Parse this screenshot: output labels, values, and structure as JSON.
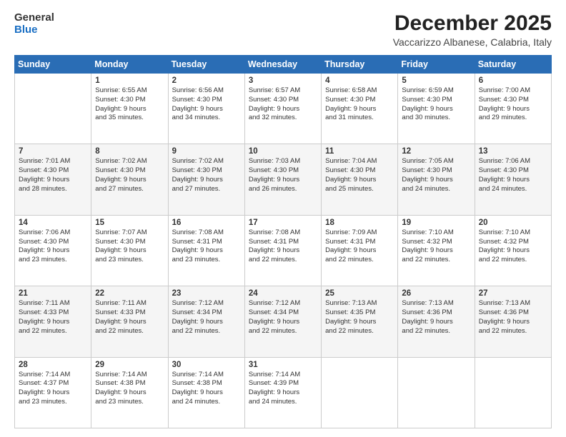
{
  "header": {
    "logo_line1": "General",
    "logo_line2": "Blue",
    "title": "December 2025",
    "subtitle": "Vaccarizzo Albanese, Calabria, Italy"
  },
  "weekdays": [
    "Sunday",
    "Monday",
    "Tuesday",
    "Wednesday",
    "Thursday",
    "Friday",
    "Saturday"
  ],
  "weeks": [
    [
      {
        "day": "",
        "info": ""
      },
      {
        "day": "1",
        "info": "Sunrise: 6:55 AM\nSunset: 4:30 PM\nDaylight: 9 hours\nand 35 minutes."
      },
      {
        "day": "2",
        "info": "Sunrise: 6:56 AM\nSunset: 4:30 PM\nDaylight: 9 hours\nand 34 minutes."
      },
      {
        "day": "3",
        "info": "Sunrise: 6:57 AM\nSunset: 4:30 PM\nDaylight: 9 hours\nand 32 minutes."
      },
      {
        "day": "4",
        "info": "Sunrise: 6:58 AM\nSunset: 4:30 PM\nDaylight: 9 hours\nand 31 minutes."
      },
      {
        "day": "5",
        "info": "Sunrise: 6:59 AM\nSunset: 4:30 PM\nDaylight: 9 hours\nand 30 minutes."
      },
      {
        "day": "6",
        "info": "Sunrise: 7:00 AM\nSunset: 4:30 PM\nDaylight: 9 hours\nand 29 minutes."
      }
    ],
    [
      {
        "day": "7",
        "info": "Sunrise: 7:01 AM\nSunset: 4:30 PM\nDaylight: 9 hours\nand 28 minutes."
      },
      {
        "day": "8",
        "info": "Sunrise: 7:02 AM\nSunset: 4:30 PM\nDaylight: 9 hours\nand 27 minutes."
      },
      {
        "day": "9",
        "info": "Sunrise: 7:02 AM\nSunset: 4:30 PM\nDaylight: 9 hours\nand 27 minutes."
      },
      {
        "day": "10",
        "info": "Sunrise: 7:03 AM\nSunset: 4:30 PM\nDaylight: 9 hours\nand 26 minutes."
      },
      {
        "day": "11",
        "info": "Sunrise: 7:04 AM\nSunset: 4:30 PM\nDaylight: 9 hours\nand 25 minutes."
      },
      {
        "day": "12",
        "info": "Sunrise: 7:05 AM\nSunset: 4:30 PM\nDaylight: 9 hours\nand 24 minutes."
      },
      {
        "day": "13",
        "info": "Sunrise: 7:06 AM\nSunset: 4:30 PM\nDaylight: 9 hours\nand 24 minutes."
      }
    ],
    [
      {
        "day": "14",
        "info": "Sunrise: 7:06 AM\nSunset: 4:30 PM\nDaylight: 9 hours\nand 23 minutes."
      },
      {
        "day": "15",
        "info": "Sunrise: 7:07 AM\nSunset: 4:30 PM\nDaylight: 9 hours\nand 23 minutes."
      },
      {
        "day": "16",
        "info": "Sunrise: 7:08 AM\nSunset: 4:31 PM\nDaylight: 9 hours\nand 23 minutes."
      },
      {
        "day": "17",
        "info": "Sunrise: 7:08 AM\nSunset: 4:31 PM\nDaylight: 9 hours\nand 22 minutes."
      },
      {
        "day": "18",
        "info": "Sunrise: 7:09 AM\nSunset: 4:31 PM\nDaylight: 9 hours\nand 22 minutes."
      },
      {
        "day": "19",
        "info": "Sunrise: 7:10 AM\nSunset: 4:32 PM\nDaylight: 9 hours\nand 22 minutes."
      },
      {
        "day": "20",
        "info": "Sunrise: 7:10 AM\nSunset: 4:32 PM\nDaylight: 9 hours\nand 22 minutes."
      }
    ],
    [
      {
        "day": "21",
        "info": "Sunrise: 7:11 AM\nSunset: 4:33 PM\nDaylight: 9 hours\nand 22 minutes."
      },
      {
        "day": "22",
        "info": "Sunrise: 7:11 AM\nSunset: 4:33 PM\nDaylight: 9 hours\nand 22 minutes."
      },
      {
        "day": "23",
        "info": "Sunrise: 7:12 AM\nSunset: 4:34 PM\nDaylight: 9 hours\nand 22 minutes."
      },
      {
        "day": "24",
        "info": "Sunrise: 7:12 AM\nSunset: 4:34 PM\nDaylight: 9 hours\nand 22 minutes."
      },
      {
        "day": "25",
        "info": "Sunrise: 7:13 AM\nSunset: 4:35 PM\nDaylight: 9 hours\nand 22 minutes."
      },
      {
        "day": "26",
        "info": "Sunrise: 7:13 AM\nSunset: 4:36 PM\nDaylight: 9 hours\nand 22 minutes."
      },
      {
        "day": "27",
        "info": "Sunrise: 7:13 AM\nSunset: 4:36 PM\nDaylight: 9 hours\nand 22 minutes."
      }
    ],
    [
      {
        "day": "28",
        "info": "Sunrise: 7:14 AM\nSunset: 4:37 PM\nDaylight: 9 hours\nand 23 minutes."
      },
      {
        "day": "29",
        "info": "Sunrise: 7:14 AM\nSunset: 4:38 PM\nDaylight: 9 hours\nand 23 minutes."
      },
      {
        "day": "30",
        "info": "Sunrise: 7:14 AM\nSunset: 4:38 PM\nDaylight: 9 hours\nand 24 minutes."
      },
      {
        "day": "31",
        "info": "Sunrise: 7:14 AM\nSunset: 4:39 PM\nDaylight: 9 hours\nand 24 minutes."
      },
      {
        "day": "",
        "info": ""
      },
      {
        "day": "",
        "info": ""
      },
      {
        "day": "",
        "info": ""
      }
    ]
  ]
}
